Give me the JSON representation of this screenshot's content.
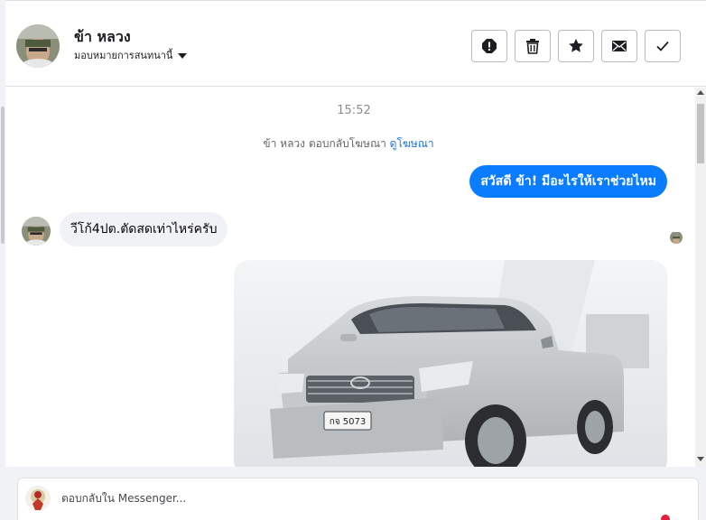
{
  "contact": {
    "name": "ข้า หลวง",
    "assign_label": "มอบหมายการสนทนานี้"
  },
  "actions": [
    {
      "icon": "spam-alert-icon"
    },
    {
      "icon": "trash-icon"
    },
    {
      "icon": "star-icon"
    },
    {
      "icon": "envelope-icon"
    },
    {
      "icon": "checkmark-icon"
    }
  ],
  "thread": {
    "timestamp": "15:52",
    "reply_info_text": "ข้า หลวง ตอบกลับโฆษณา",
    "reply_info_link": "ดูโฆษณา",
    "outgoing_message": "สวัสดี ข้า! มีอะไรให้เราช่วยไหม",
    "incoming_message": "วีโก้4ปต.ตัดสดเท่าไหร่ครับ",
    "photo_plate": "กจ 5073"
  },
  "composer": {
    "placeholder": "ตอบกลับใน Messenger..."
  },
  "colors": {
    "accent": "#0a7cff",
    "link": "#1b74e4",
    "incoming_bubble": "#f0f2f5",
    "badge": "#e41e3f"
  }
}
